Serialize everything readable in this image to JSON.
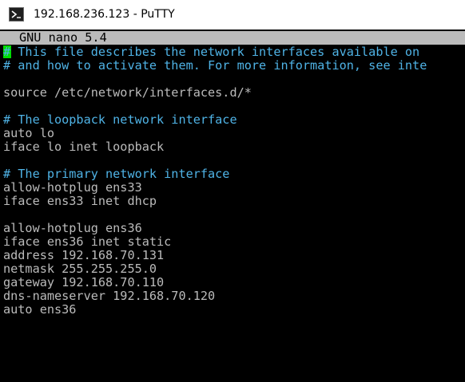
{
  "window": {
    "title": "192.168.236.123 - PuTTY",
    "icon": "putty-terminal-icon"
  },
  "editor": {
    "header": "GNU nano 5.4"
  },
  "lines": [
    {
      "text": "# This file describes the network interfaces available on",
      "type": "comment"
    },
    {
      "text": "# and how to activate them. For more information, see inte",
      "type": "comment"
    },
    {
      "text": "",
      "type": "blank"
    },
    {
      "text": "source /etc/network/interfaces.d/*",
      "type": "code"
    },
    {
      "text": "",
      "type": "blank"
    },
    {
      "text": "# The loopback network interface",
      "type": "comment"
    },
    {
      "text": "auto lo",
      "type": "code"
    },
    {
      "text": "iface lo inet loopback",
      "type": "code"
    },
    {
      "text": "",
      "type": "blank"
    },
    {
      "text": "# The primary network interface",
      "type": "comment"
    },
    {
      "text": "allow-hotplug ens33",
      "type": "code"
    },
    {
      "text": "iface ens33 inet dhcp",
      "type": "code"
    },
    {
      "text": "",
      "type": "blank"
    },
    {
      "text": "allow-hotplug ens36",
      "type": "code"
    },
    {
      "text": "iface ens36 inet static",
      "type": "code"
    },
    {
      "text": "address 192.168.70.131",
      "type": "code"
    },
    {
      "text": "netmask 255.255.255.0",
      "type": "code"
    },
    {
      "text": "gateway 192.168.70.110",
      "type": "code"
    },
    {
      "text": "dns-nameserver 192.168.70.120",
      "type": "code"
    },
    {
      "text": "auto ens36",
      "type": "code"
    }
  ],
  "colors": {
    "background": "#000000",
    "text": "#bbbbbb",
    "comment": "#4fb3e6",
    "cursor": "#00dd00",
    "header_bar": "#bbbbbb"
  }
}
